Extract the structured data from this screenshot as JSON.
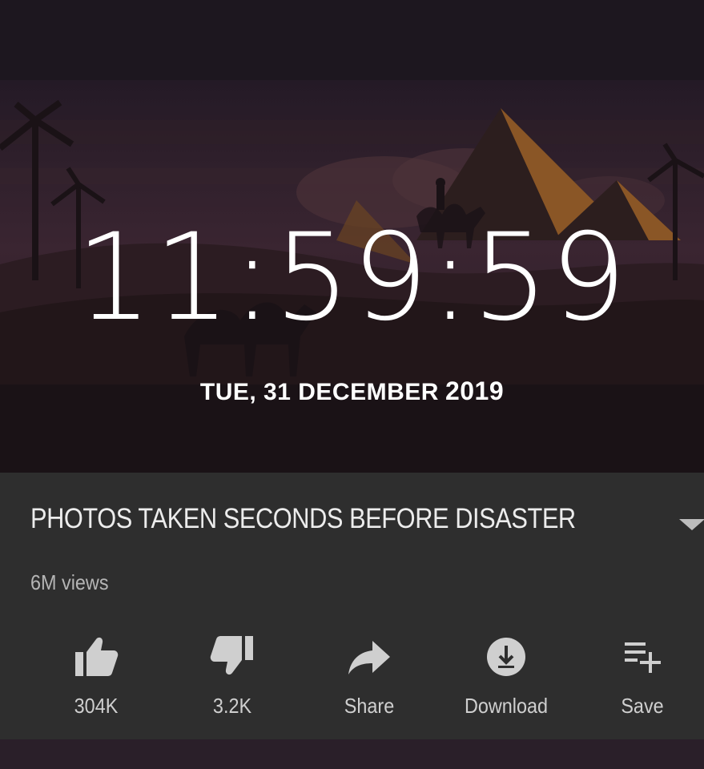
{
  "player": {
    "clock": "11:59:59",
    "date": "TUE, 31 DECEMBER",
    "year": "2019"
  },
  "video": {
    "title": "PHOTOS TAKEN SECONDS BEFORE DISASTER",
    "views": "6M views"
  },
  "actions": {
    "like": "304K",
    "dislike": "3.2K",
    "share": "Share",
    "download": "Download",
    "save": "Save"
  },
  "colors": {
    "panel_bg": "#2e2e2e",
    "video_bg": "#221a24",
    "pyramid_accent": "#a86a2a",
    "icon_color": "#cfcfcf"
  },
  "icons": [
    "thumbs-up-icon",
    "thumbs-down-icon",
    "share-arrow-icon",
    "download-icon",
    "playlist-add-icon",
    "chevron-down-icon"
  ]
}
